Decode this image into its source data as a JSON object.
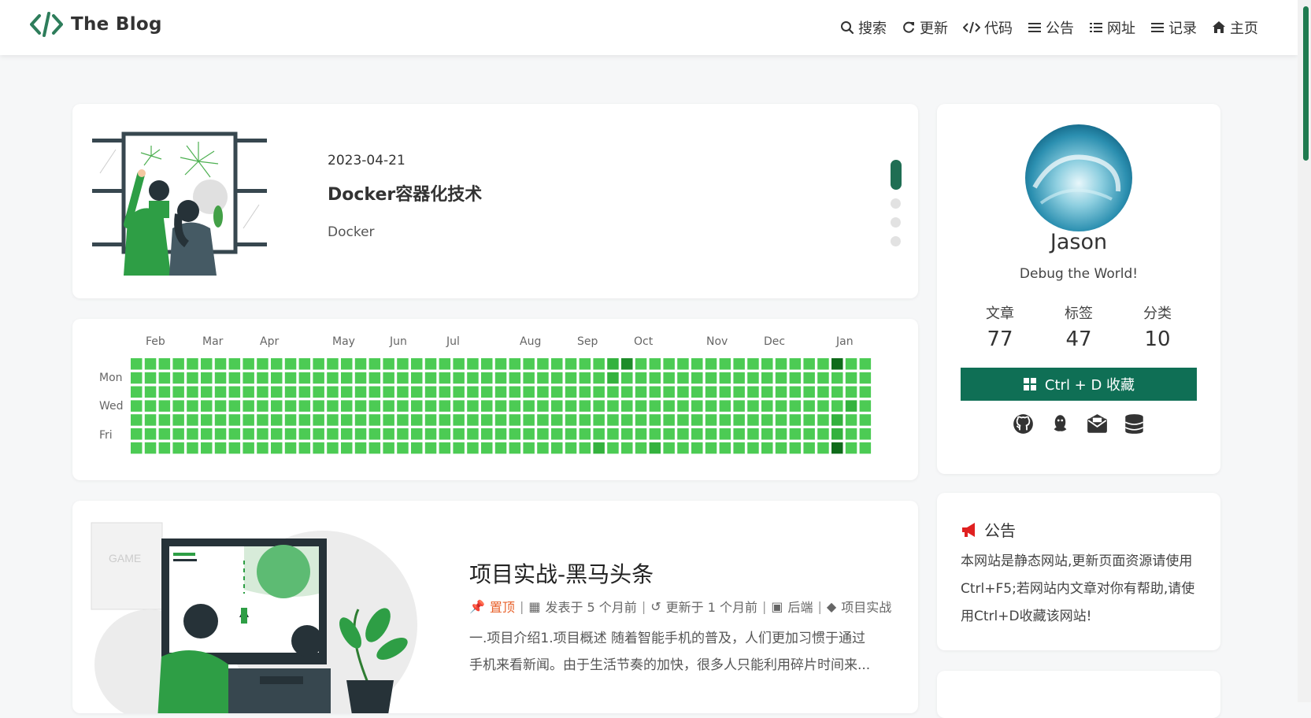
{
  "brand": {
    "title": "The Blog",
    "logo_icon": "code-brackets-icon",
    "accent": "#2e7d5b"
  },
  "nav": {
    "items": [
      {
        "label": "搜索",
        "icon": "search-icon"
      },
      {
        "label": "更新",
        "icon": "refresh-icon"
      },
      {
        "label": "代码",
        "icon": "code-icon"
      },
      {
        "label": "公告",
        "icon": "list-icon"
      },
      {
        "label": "网址",
        "icon": "list-ul-icon"
      },
      {
        "label": "记录",
        "icon": "list-icon"
      },
      {
        "label": "主页",
        "icon": "home-icon"
      }
    ]
  },
  "featured": {
    "date": "2023-04-21",
    "title": "Docker容器化技术",
    "category": "Docker",
    "slides": 4,
    "active_slide": 1
  },
  "heatmap": {
    "months": [
      "Feb",
      "Mar",
      "Apr",
      "May",
      "Jun",
      "Jul",
      "Aug",
      "Sep",
      "Oct",
      "Nov",
      "Dec",
      "Jan"
    ],
    "day_labels": [
      "Mon",
      "Wed",
      "Fri"
    ],
    "colors": {
      "level0": "#4ccb54",
      "level1": "#34b23e",
      "level2": "#1e8c2a",
      "level3": "#0f6b1a"
    }
  },
  "post": {
    "title": "项目实战-黑马头条",
    "pinned_label": "置顶",
    "published": "发表于 5 个月前",
    "updated": "更新于 1 个月前",
    "category": "后端",
    "tag": "项目实战",
    "excerpt": "一.项目介绍1.项目概述 随着智能手机的普及，人们更加习惯于通过手机来看新闻。由于生活节奏的加快，很多人只能利用碎片时间来..."
  },
  "profile": {
    "name": "Jason",
    "motto": "Debug the World!",
    "stats": [
      {
        "label": "文章",
        "value": "77"
      },
      {
        "label": "标签",
        "value": "47"
      },
      {
        "label": "分类",
        "value": "10"
      }
    ],
    "bookmark_button": "Ctrl + D 收藏",
    "socials": [
      "github-icon",
      "qq-icon",
      "mail-icon",
      "database-icon"
    ]
  },
  "notice": {
    "title": "公告",
    "text": "本网站是静态网站,更新页面资源请使用Ctrl+F5;若网站内文章对你有帮助,请使用Ctrl+D收藏该网站!"
  }
}
